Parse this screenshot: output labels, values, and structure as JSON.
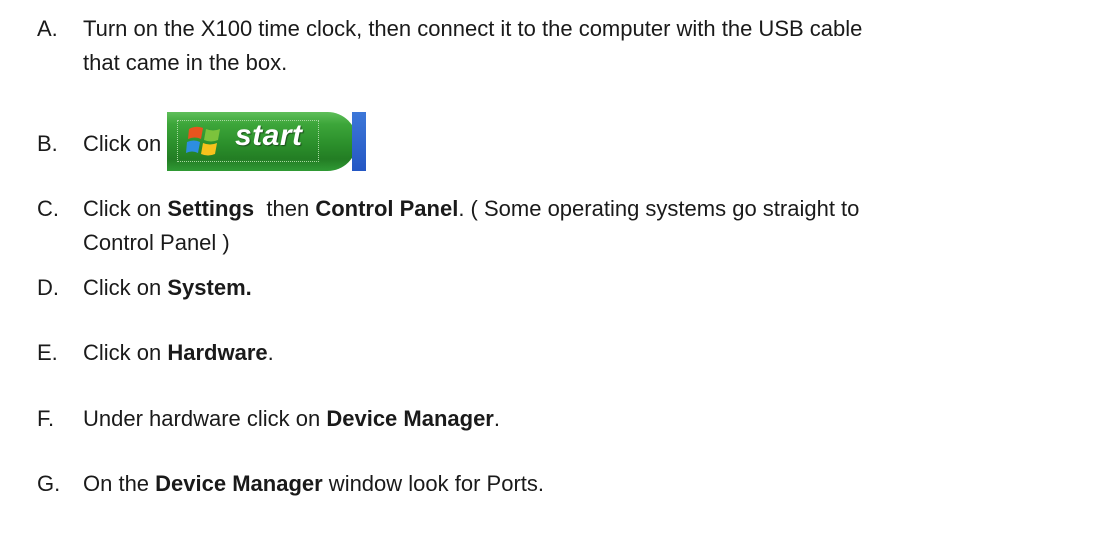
{
  "steps": [
    {
      "letter": "A.",
      "line1": "Turn on the X100 time clock, then connect it to the computer with the  USB cable",
      "line2": "that came in the box."
    },
    {
      "letter": "B.",
      "text": "Click on",
      "button_label": "start",
      "button_icon": "windows-logo-icon"
    },
    {
      "letter": "C.",
      "pre": "Click on ",
      "bold1": "Settings",
      "mid": "  then ",
      "bold2": "Control Panel",
      "post": ". ( Some operating systems go straight to",
      "line2": "Control Panel )"
    },
    {
      "letter": "D.",
      "pre": "Click on ",
      "bold": "System."
    },
    {
      "letter": "E.",
      "pre": "Click on ",
      "bold": "Hardware",
      "post": "."
    },
    {
      "letter": "F.",
      "pre": "Under hardware click on ",
      "bold": "Device Manager",
      "post": "."
    },
    {
      "letter": "G.",
      "pre": "On the ",
      "bold": "Device Manager",
      "post": " window look for Ports."
    }
  ],
  "colors": {
    "start_green": "#3da63a",
    "taskbar_blue": "#2457c4",
    "text": "#1a1a1a"
  }
}
